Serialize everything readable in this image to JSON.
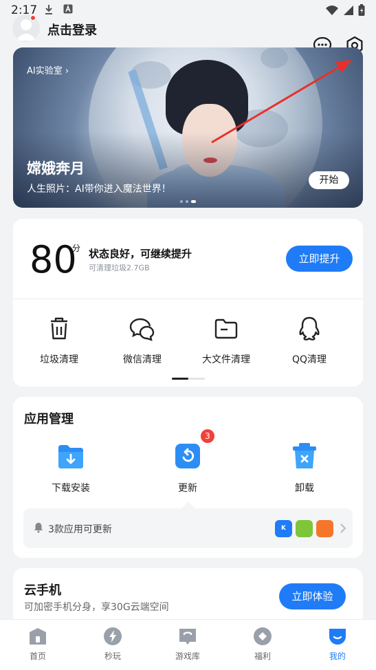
{
  "status_bar": {
    "time": "2:17"
  },
  "header": {
    "login_label": "点击登录",
    "chat_icon": "chat-bubble-icon",
    "settings_icon": "hexagon-settings-icon"
  },
  "banner": {
    "tag": "AI实验室 ›",
    "title": "嫦娥奔月",
    "subtitle": "人生照片：AI带你进入魔法世界！",
    "start_button": "开始",
    "page_count": 3,
    "active_page": 3
  },
  "score": {
    "value": "80",
    "unit": "分",
    "status": "状态良好，可继续提升",
    "desc": "可清理垃圾2.7GB",
    "boost_button": "立即提升"
  },
  "tools": [
    {
      "label": "垃圾清理",
      "icon": "trash-icon"
    },
    {
      "label": "微信清理",
      "icon": "wechat-icon"
    },
    {
      "label": "大文件清理",
      "icon": "folder-icon"
    },
    {
      "label": "QQ清理",
      "icon": "qq-penguin-icon"
    }
  ],
  "app_management": {
    "title": "应用管理",
    "items": [
      {
        "label": "下载安装",
        "icon": "download-folder-icon"
      },
      {
        "label": "更新",
        "icon": "update-icon",
        "badge": "3"
      },
      {
        "label": "卸载",
        "icon": "uninstall-trash-icon"
      }
    ],
    "update_notice": "3款应用可更新",
    "mini_apps": [
      {
        "icon": "kuwo-app-icon",
        "color": "#1f7cf6",
        "text": "K"
      },
      {
        "icon": "green-app-icon",
        "color": "#7ec53a",
        "text": ""
      },
      {
        "icon": "orange-app-icon",
        "color": "#f5762a",
        "text": ""
      }
    ]
  },
  "cloud_phone": {
    "title": "云手机",
    "desc": "可加密手机分身，享30G云端空间",
    "button": "立即体验"
  },
  "bottom_nav": [
    {
      "label": "首页",
      "icon": "home-icon",
      "active": false
    },
    {
      "label": "秒玩",
      "icon": "lightning-icon",
      "active": false
    },
    {
      "label": "游戏库",
      "icon": "game-library-icon",
      "active": false
    },
    {
      "label": "福利",
      "icon": "gift-diamond-icon",
      "active": false
    },
    {
      "label": "我的",
      "icon": "profile-icon",
      "active": true
    }
  ],
  "colors": {
    "accent": "#1f7cf6",
    "badge": "#f0413a",
    "arrow": "#e8302a"
  }
}
